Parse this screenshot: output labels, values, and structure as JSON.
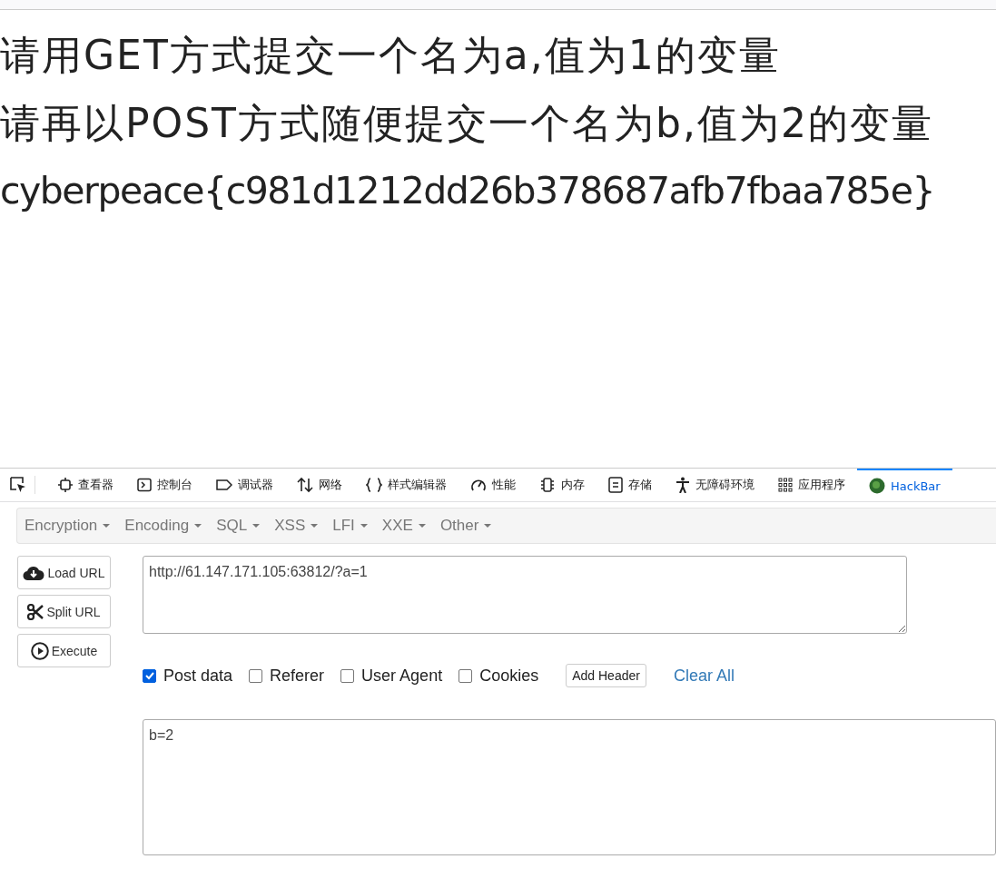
{
  "page": {
    "lines": [
      "请用GET方式提交一个名为a,值为1的变量",
      "请再以POST方式随便提交一个名为b,值为2的变量",
      "cyberpeace{c981d1212dd26b378687afb7fbaa785e}"
    ]
  },
  "devtools": {
    "tabs": [
      {
        "label": "查看器",
        "kind": "inspector",
        "selected": false
      },
      {
        "label": "控制台",
        "kind": "console",
        "selected": false
      },
      {
        "label": "调试器",
        "kind": "debugger",
        "selected": false
      },
      {
        "label": "网络",
        "kind": "network",
        "selected": false
      },
      {
        "label": "样式编辑器",
        "kind": "style",
        "selected": false
      },
      {
        "label": "性能",
        "kind": "performance",
        "selected": false
      },
      {
        "label": "内存",
        "kind": "memory",
        "selected": false
      },
      {
        "label": "存储",
        "kind": "storage",
        "selected": false
      },
      {
        "label": "无障碍环境",
        "kind": "accessibility",
        "selected": false
      },
      {
        "label": "应用程序",
        "kind": "application",
        "selected": false
      },
      {
        "label": "HackBar",
        "kind": "hackbar",
        "selected": true
      }
    ]
  },
  "hackbar": {
    "menus": [
      "Encryption",
      "Encoding",
      "SQL",
      "XSS",
      "LFI",
      "XXE",
      "Other"
    ],
    "actions": [
      {
        "label": "Load URL",
        "kind": "load"
      },
      {
        "label": "Split URL",
        "kind": "split"
      },
      {
        "label": "Execute",
        "kind": "execute"
      }
    ],
    "url": "http://61.147.171.105:63812/?a=1",
    "options": [
      {
        "label": "Post data",
        "checked": true
      },
      {
        "label": "Referer",
        "checked": false
      },
      {
        "label": "User Agent",
        "checked": false
      },
      {
        "label": "Cookies",
        "checked": false
      }
    ],
    "add_header": "Add Header",
    "clear_all": "Clear All",
    "post_body": "b=2"
  }
}
